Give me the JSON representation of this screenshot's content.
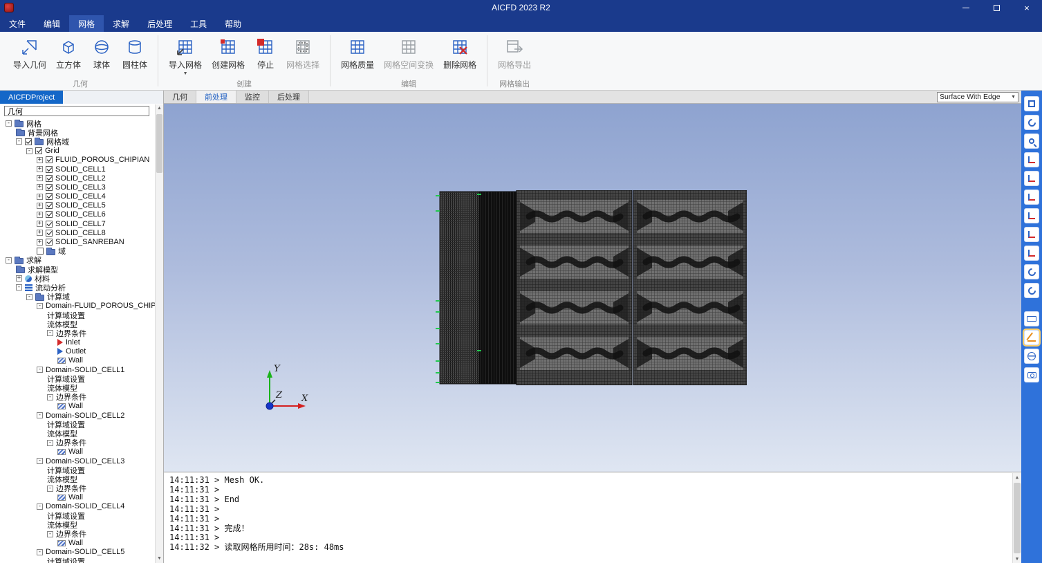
{
  "window": {
    "title": "AICFD 2023 R2"
  },
  "menu": {
    "active_index": 2,
    "items": [
      {
        "key": "file",
        "label": "文件"
      },
      {
        "key": "edit",
        "label": "编辑"
      },
      {
        "key": "mesh",
        "label": "网格"
      },
      {
        "key": "solve",
        "label": "求解"
      },
      {
        "key": "post",
        "label": "后处理"
      },
      {
        "key": "tools",
        "label": "工具"
      },
      {
        "key": "help",
        "label": "帮助"
      }
    ]
  },
  "ribbon": {
    "groups": [
      {
        "label": "几何",
        "buttons": [
          {
            "label": "导入几何",
            "icon": "import-geometry-icon"
          },
          {
            "label": "立方体",
            "icon": "cube-icon"
          },
          {
            "label": "球体",
            "icon": "sphere-icon"
          },
          {
            "label": "圆柱体",
            "icon": "cylinder-icon"
          }
        ]
      },
      {
        "label": "创建",
        "buttons": [
          {
            "label": "导入网格",
            "icon": "import-mesh-icon",
            "has_dropdown": true
          },
          {
            "label": "创建网格",
            "icon": "create-mesh-icon"
          },
          {
            "label": "停止",
            "icon": "stop-mesh-icon"
          },
          {
            "label": "网格选择",
            "icon": "mesh-select-icon",
            "disabled": true
          }
        ]
      },
      {
        "label": "编辑",
        "buttons": [
          {
            "label": "网格质量",
            "icon": "mesh-quality-icon"
          },
          {
            "label": "网格空间变换",
            "icon": "mesh-transform-icon",
            "disabled": true
          },
          {
            "label": "删除网格",
            "icon": "delete-mesh-icon"
          }
        ]
      },
      {
        "label": "网格输出",
        "buttons": [
          {
            "label": "网格导出",
            "icon": "mesh-export-icon",
            "disabled": true
          }
        ]
      }
    ]
  },
  "project_panel": {
    "title": "AICFDProject",
    "search_value": "几何",
    "tree": [
      {
        "l": 0,
        "e": "-",
        "i": "folder",
        "t": "网格"
      },
      {
        "l": 1,
        "i": "folder",
        "t": "背景网格"
      },
      {
        "l": 1,
        "e": "-",
        "c": true,
        "i": "folder",
        "t": "网格域"
      },
      {
        "l": 2,
        "e": "-",
        "c": true,
        "t": "Grid"
      },
      {
        "l": 3,
        "e": "+",
        "c": true,
        "t": "FLUID_POROUS_CHIPIAN"
      },
      {
        "l": 3,
        "e": "+",
        "c": true,
        "t": "SOLID_CELL1"
      },
      {
        "l": 3,
        "e": "+",
        "c": true,
        "t": "SOLID_CELL2"
      },
      {
        "l": 3,
        "e": "+",
        "c": true,
        "t": "SOLID_CELL3"
      },
      {
        "l": 3,
        "e": "+",
        "c": true,
        "t": "SOLID_CELL4"
      },
      {
        "l": 3,
        "e": "+",
        "c": true,
        "t": "SOLID_CELL5"
      },
      {
        "l": 3,
        "e": "+",
        "c": true,
        "t": "SOLID_CELL6"
      },
      {
        "l": 3,
        "e": "+",
        "c": true,
        "t": "SOLID_CELL7"
      },
      {
        "l": 3,
        "e": "+",
        "c": true,
        "t": "SOLID_CELL8"
      },
      {
        "l": 3,
        "e": "+",
        "c": true,
        "t": "SOLID_SANREBAN"
      },
      {
        "l": 3,
        "c": false,
        "i": "folder",
        "t": "域"
      },
      {
        "l": 0,
        "e": "-",
        "i": "folder",
        "t": "求解"
      },
      {
        "l": 1,
        "i": "folder",
        "t": "求解模型"
      },
      {
        "l": 1,
        "e": "+",
        "i": "materials",
        "t": "材料"
      },
      {
        "l": 1,
        "e": "-",
        "i": "analysis",
        "t": "流动分析"
      },
      {
        "l": 2,
        "e": "-",
        "i": "folder",
        "t": "计算域"
      },
      {
        "l": 3,
        "e": "-",
        "t": "Domain-FLUID_POROUS_CHIPIAN"
      },
      {
        "l": 4,
        "t": "计算域设置"
      },
      {
        "l": 4,
        "t": "流体模型"
      },
      {
        "l": 4,
        "e": "-",
        "t": "边界条件"
      },
      {
        "l": 5,
        "i": "inlet",
        "t": "Inlet"
      },
      {
        "l": 5,
        "i": "outlet",
        "t": "Outlet"
      },
      {
        "l": 5,
        "i": "wall",
        "t": "Wall"
      },
      {
        "l": 3,
        "e": "-",
        "t": "Domain-SOLID_CELL1"
      },
      {
        "l": 4,
        "t": "计算域设置"
      },
      {
        "l": 4,
        "t": "流体模型"
      },
      {
        "l": 4,
        "e": "-",
        "t": "边界条件"
      },
      {
        "l": 5,
        "i": "wall",
        "t": "Wall"
      },
      {
        "l": 3,
        "e": "-",
        "t": "Domain-SOLID_CELL2"
      },
      {
        "l": 4,
        "t": "计算域设置"
      },
      {
        "l": 4,
        "t": "流体模型"
      },
      {
        "l": 4,
        "e": "-",
        "t": "边界条件"
      },
      {
        "l": 5,
        "i": "wall",
        "t": "Wall"
      },
      {
        "l": 3,
        "e": "-",
        "t": "Domain-SOLID_CELL3"
      },
      {
        "l": 4,
        "t": "计算域设置"
      },
      {
        "l": 4,
        "t": "流体模型"
      },
      {
        "l": 4,
        "e": "-",
        "t": "边界条件"
      },
      {
        "l": 5,
        "i": "wall",
        "t": "Wall"
      },
      {
        "l": 3,
        "e": "-",
        "t": "Domain-SOLID_CELL4"
      },
      {
        "l": 4,
        "t": "计算域设置"
      },
      {
        "l": 4,
        "t": "流体模型"
      },
      {
        "l": 4,
        "e": "-",
        "t": "边界条件"
      },
      {
        "l": 5,
        "i": "wall",
        "t": "Wall"
      },
      {
        "l": 3,
        "e": "-",
        "t": "Domain-SOLID_CELL5"
      },
      {
        "l": 4,
        "t": "计算域设置"
      }
    ]
  },
  "viewport": {
    "tabs": [
      "几何",
      "前处理",
      "监控",
      "后处理"
    ],
    "active_tab": "前处理",
    "display_mode": "Surface With Edge",
    "axis_labels": {
      "x": "X",
      "y": "Y",
      "z": "Z"
    }
  },
  "right_toolbar": {
    "active": "measure-angle-icon",
    "gap_before": "keyboard-shortcuts-icon",
    "icons": [
      "screen-layout-icon",
      "refresh-view-icon",
      "fit-view-icon",
      "view-left-icon",
      "view-right-icon",
      "view-front-icon",
      "view-back-icon",
      "view-top-icon",
      "view-bottom-icon",
      "rotate-ccw-icon",
      "rotate-cw-icon",
      "keyboard-shortcuts-icon",
      "measure-angle-icon",
      "render-style-icon",
      "screenshot-icon"
    ]
  },
  "console": {
    "lines": [
      "14:11:31 > Mesh OK.",
      "14:11:31 >",
      "14:11:31 > End",
      "14:11:31 >",
      "14:11:31 >",
      "14:11:31 > 完成！",
      "14:11:31 >",
      "14:11:32 > 读取网格所用时间：28s: 48ms"
    ]
  }
}
